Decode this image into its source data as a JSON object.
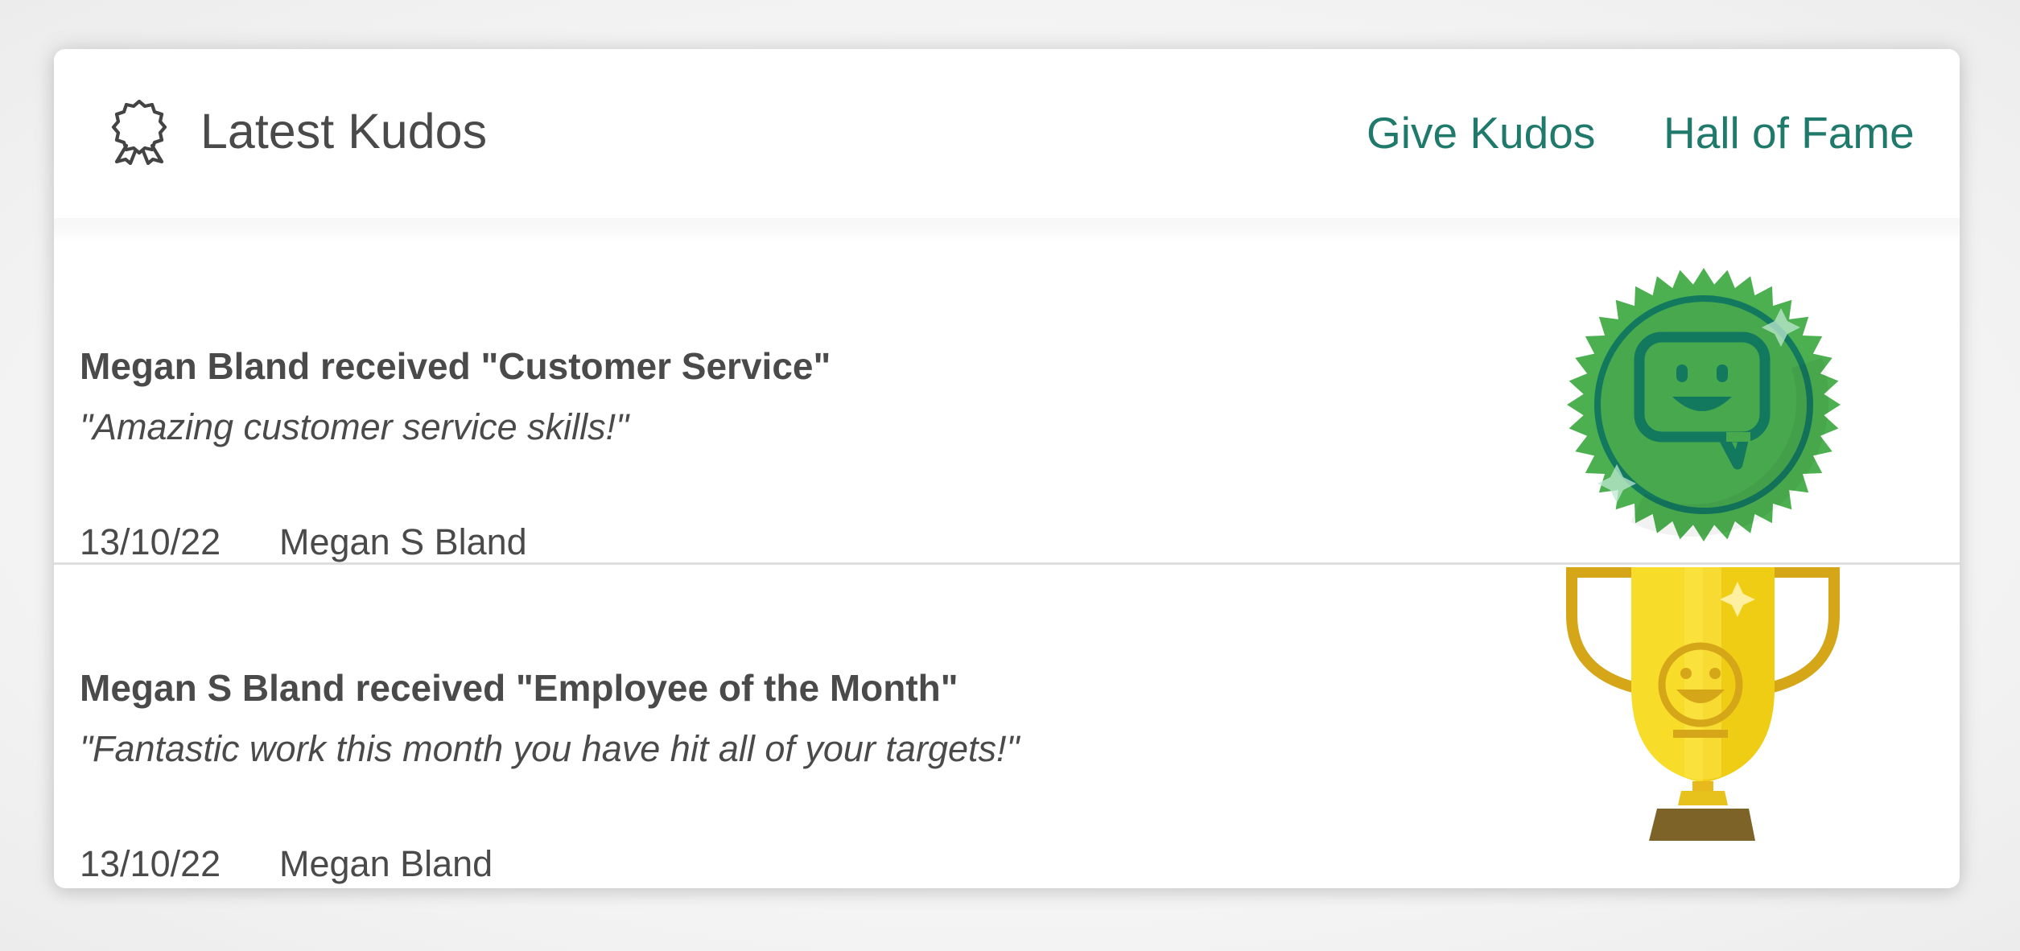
{
  "widget": {
    "title": "Latest Kudos",
    "icon": "award-ribbon-icon",
    "links": {
      "give_kudos": "Give Kudos",
      "hall_of_fame": "Hall of Fame"
    },
    "link_color": "#1f7a6c"
  },
  "kudos": [
    {
      "title": "Megan Bland received \"Customer Service\"",
      "quote": "\"Amazing customer service skills!\"",
      "date": "13/10/22",
      "giver": "Megan S Bland",
      "badge_icon": "customer-service-badge-icon",
      "badge_color": "#4caf50"
    },
    {
      "title": "Megan S Bland received \"Employee of the Month\"",
      "quote": "\"Fantastic work this month you have hit all of your targets!\"",
      "date": "13/10/22",
      "giver": "Megan Bland",
      "badge_icon": "trophy-icon",
      "badge_color": "#f5d020"
    }
  ]
}
